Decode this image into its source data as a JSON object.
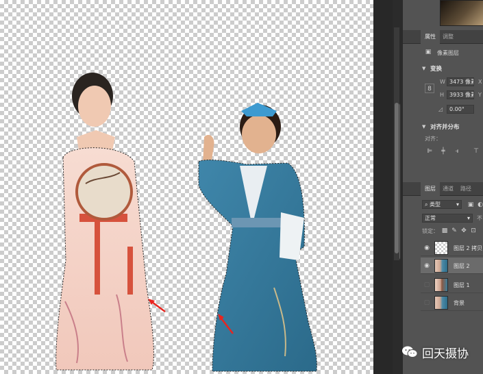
{
  "properties_panel": {
    "tabs": [
      {
        "label": "属性",
        "active": true
      },
      {
        "label": "调整",
        "active": false
      }
    ],
    "layer_type": "像素图层",
    "transform": {
      "heading": "变换",
      "w_label": "W",
      "w_value": "3473 像素",
      "x_label": "X",
      "h_label": "H",
      "h_value": "3933 像素",
      "y_label": "Y",
      "angle_value": "0.00°"
    },
    "align": {
      "heading": "对齐并分布",
      "label": "对齐："
    }
  },
  "layers_panel": {
    "tabs": [
      {
        "label": "图层",
        "active": true
      },
      {
        "label": "通道",
        "active": false
      },
      {
        "label": "路径",
        "active": false
      }
    ],
    "filter_kind": "类型",
    "blend_mode": "正常",
    "opacity_label": "不",
    "lock_label": "锁定：",
    "layers": [
      {
        "name": "图层 2 拷贝",
        "visible": true,
        "selected": false,
        "thumb": "transparent"
      },
      {
        "name": "图层 2",
        "visible": true,
        "selected": true,
        "thumb": "photo"
      },
      {
        "name": "图层 1",
        "visible": false,
        "selected": false,
        "thumb": "photo2"
      },
      {
        "name": "背景",
        "visible": false,
        "selected": false,
        "thumb": "photo"
      }
    ]
  },
  "watermark": {
    "text": "回天摄协",
    "icon": "wechat-icon"
  },
  "colors": {
    "panel_bg": "#535353",
    "tab_bar": "#424242",
    "selected_row": "#6b6b6b",
    "arrow": "#e8251f"
  }
}
